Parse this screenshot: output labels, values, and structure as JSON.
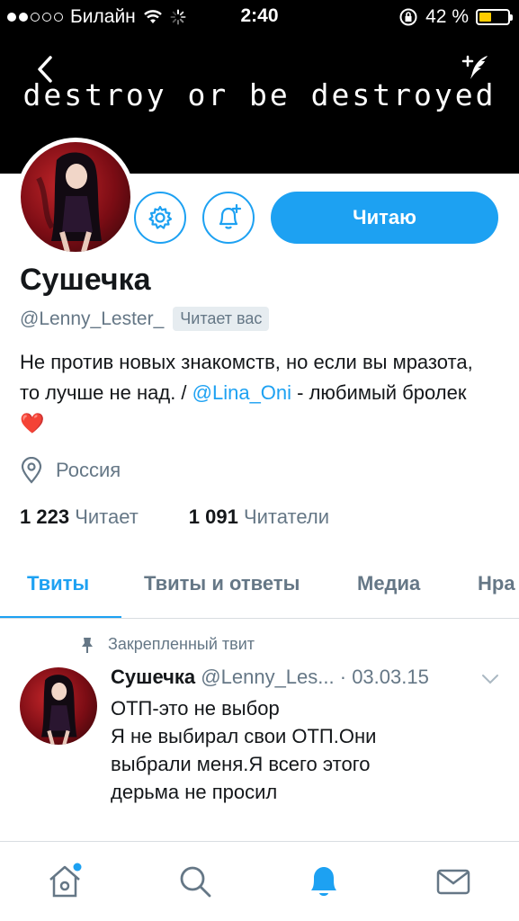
{
  "status_bar": {
    "dots": 5,
    "dots_filled": 2,
    "carrier": "Билайн",
    "time": "2:40",
    "battery": "42 %",
    "battery_level": 0.42
  },
  "header": {
    "banner_text": "destroy or be destroyed",
    "back_icon": "chevron-left-icon",
    "compose_icon": "compose-feather-icon"
  },
  "profile": {
    "name": "Сушечка",
    "handle": "@Lenny_Lester_",
    "follows_you": "Читает вас",
    "follow_label": "Читаю",
    "bio_text_1": "Не против новых знакомств, но если вы мразота, то лучше не над. / ",
    "bio_mention": "@Lina_Oni",
    "bio_text_2": " - любимый бролек",
    "bio_emoji": "❤️",
    "location": "Россия",
    "following_count": "1 223",
    "following_label": "Читает",
    "followers_count": "1 091",
    "followers_label": "Читатели"
  },
  "tabs": [
    {
      "label": "Твиты",
      "active": true
    },
    {
      "label": "Твиты и ответы",
      "active": false
    },
    {
      "label": "Медиа",
      "active": false
    },
    {
      "label": "Нра",
      "active": false
    }
  ],
  "tweet": {
    "pinned_label": "Закрепленный твит",
    "name": "Сушечка",
    "handle": "@Lenny_Les...",
    "date": "· 03.03.15",
    "lines": [
      "ОТП-это не выбор",
      "Я не выбирал свои ОТП.Они",
      "выбрали меня.Я всего этого",
      "дерьма не просил"
    ]
  },
  "bottom_nav": {
    "items": [
      {
        "icon": "home-icon",
        "active": false,
        "badge": true
      },
      {
        "icon": "search-icon",
        "active": false,
        "badge": false
      },
      {
        "icon": "bell-icon",
        "active": true,
        "badge": false
      },
      {
        "icon": "mail-icon",
        "active": false,
        "badge": false
      }
    ]
  },
  "colors": {
    "accent": "#1da1f2",
    "muted": "#657786",
    "text": "#14171a",
    "battery": "#ffcc00"
  }
}
